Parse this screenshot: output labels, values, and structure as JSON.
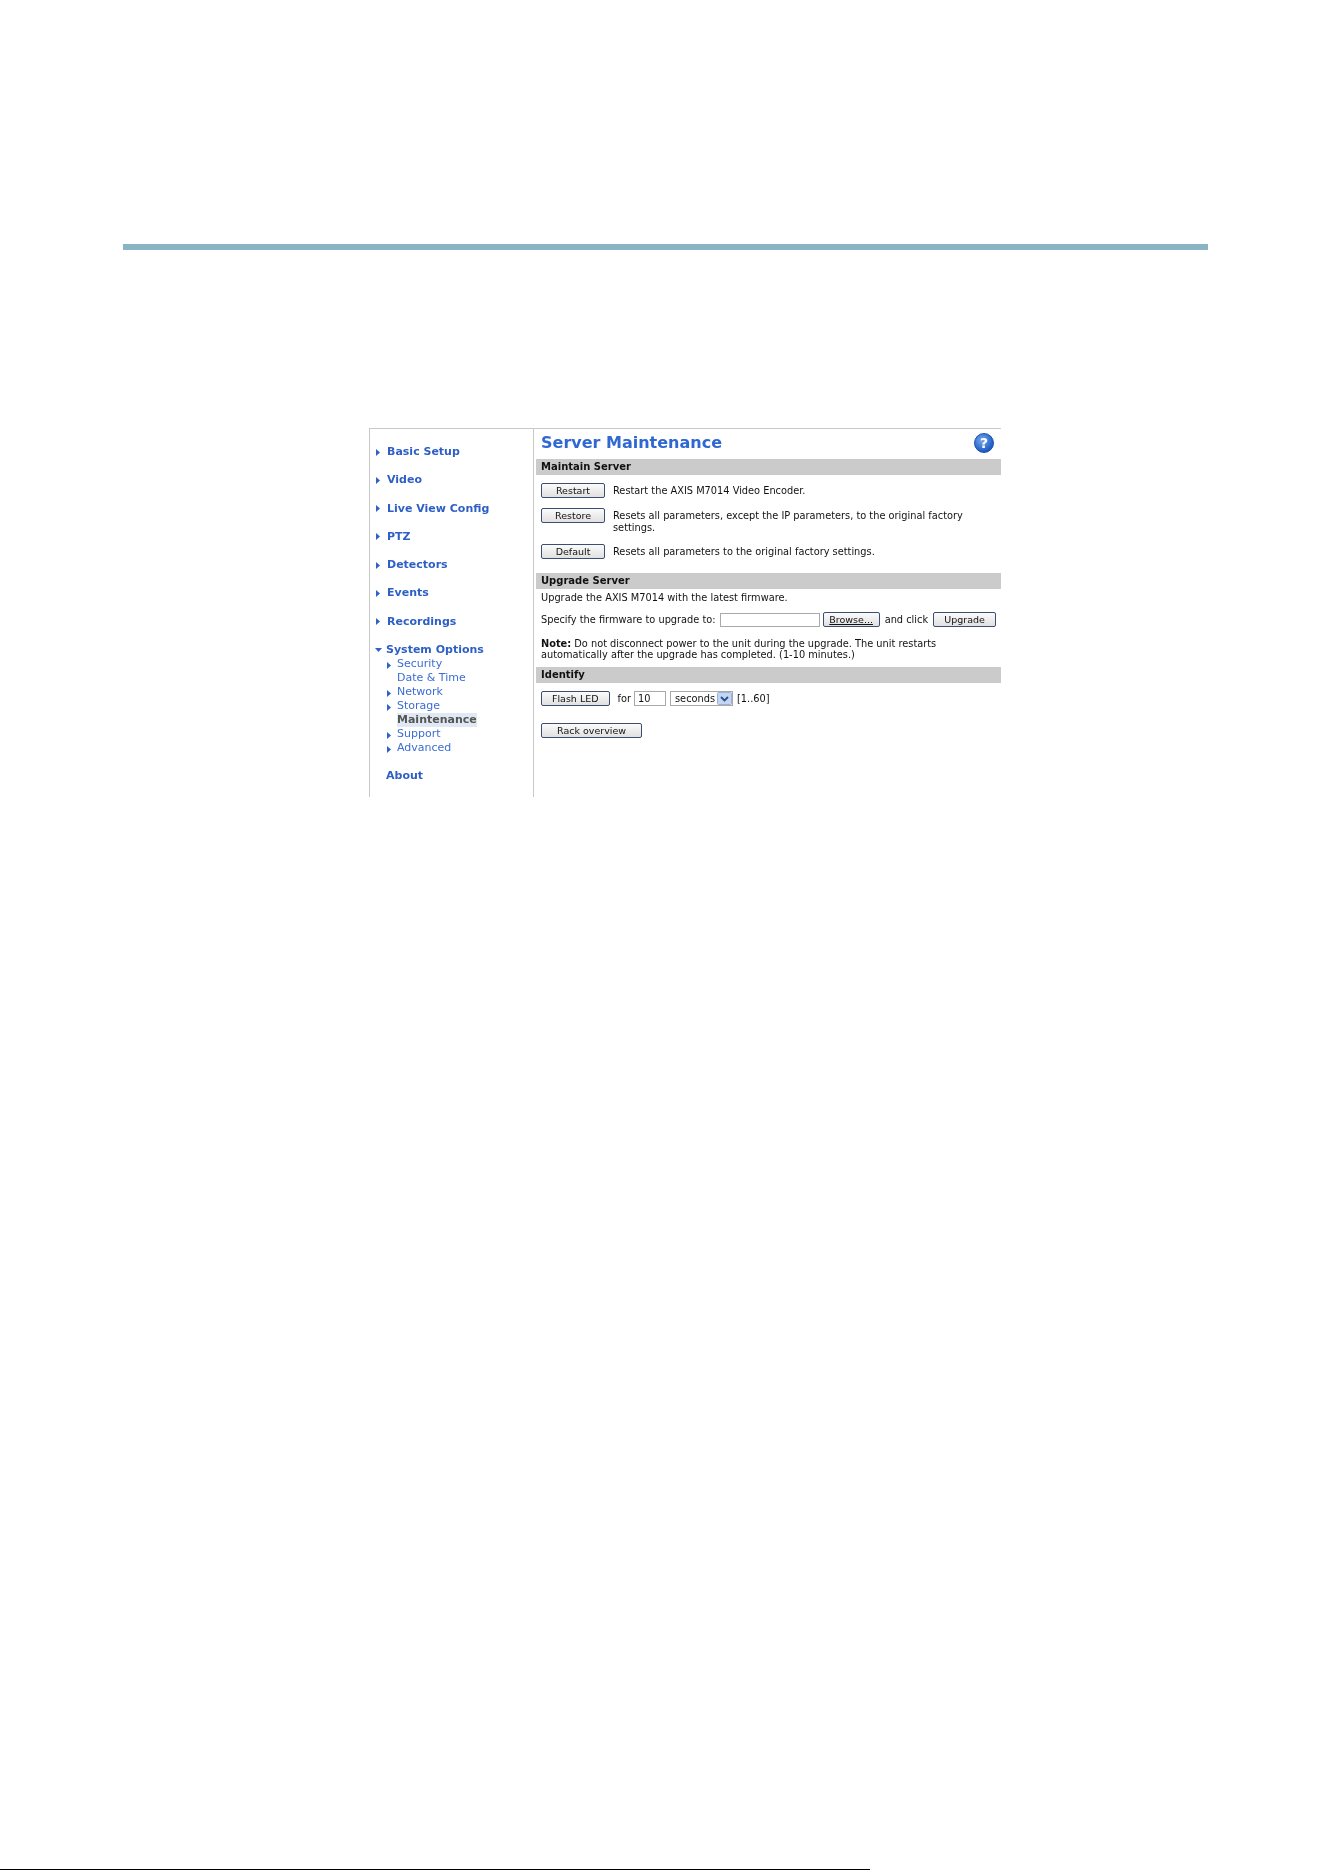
{
  "page": {
    "title": "Server Maintenance",
    "help": "?"
  },
  "nav": {
    "items": [
      {
        "label": "Basic Setup",
        "kind": "group",
        "expanded": false,
        "selected": false
      },
      {
        "label": "Video",
        "kind": "group",
        "expanded": false,
        "selected": false
      },
      {
        "label": "Live View Config",
        "kind": "group",
        "expanded": false,
        "selected": false
      },
      {
        "label": "PTZ",
        "kind": "group",
        "expanded": false,
        "selected": false
      },
      {
        "label": "Detectors",
        "kind": "group",
        "expanded": false,
        "selected": false
      },
      {
        "label": "Events",
        "kind": "group",
        "expanded": false,
        "selected": false
      },
      {
        "label": "Recordings",
        "kind": "group",
        "expanded": false,
        "selected": false
      },
      {
        "label": "System Options",
        "kind": "group",
        "expanded": true,
        "selected": false,
        "children": [
          {
            "label": "Security",
            "kind": "group",
            "expanded": false,
            "selected": false
          },
          {
            "label": "Date & Time",
            "kind": "page",
            "expanded": false,
            "selected": false
          },
          {
            "label": "Network",
            "kind": "group",
            "expanded": false,
            "selected": false
          },
          {
            "label": "Storage",
            "kind": "group",
            "expanded": false,
            "selected": false
          },
          {
            "label": "Maintenance",
            "kind": "page",
            "expanded": false,
            "selected": true
          },
          {
            "label": "Support",
            "kind": "group",
            "expanded": false,
            "selected": false
          },
          {
            "label": "Advanced",
            "kind": "group",
            "expanded": false,
            "selected": false
          }
        ]
      },
      {
        "label": "About",
        "kind": "page",
        "expanded": false,
        "selected": false
      }
    ]
  },
  "sections": [
    {
      "heading": "Maintain Server",
      "rows": [
        {
          "kind": "action",
          "button": "Restart",
          "text": "Restart the AXIS M7014 Video Encoder."
        },
        {
          "kind": "action",
          "button": "Restore",
          "text": "Resets all parameters, except the IP parameters, to the original factory settings."
        },
        {
          "kind": "action",
          "button": "Default",
          "text": "Resets all parameters to the original factory settings."
        }
      ]
    },
    {
      "heading": "Upgrade Server",
      "rows": [
        {
          "kind": "text",
          "text": "Upgrade the AXIS M7014 with the latest firmware."
        },
        {
          "kind": "file",
          "label": "Specify the firmware to upgrade to:",
          "browse": "Browse...",
          "joiner": "and click",
          "button": "Upgrade"
        },
        {
          "kind": "note",
          "text": "**Note:** Do not disconnect power to the unit during the upgrade. The unit restarts automatically after the upgrade has completed. (1-10 minutes.)"
        }
      ]
    },
    {
      "heading": "Identify",
      "rows": [
        {
          "kind": "identify",
          "button": "Flash LED",
          "label": "for",
          "value": "10",
          "unit": "seconds",
          "range": "[1..60]"
        },
        {
          "kind": "button",
          "button": "Rack overview"
        }
      ]
    }
  ]
}
